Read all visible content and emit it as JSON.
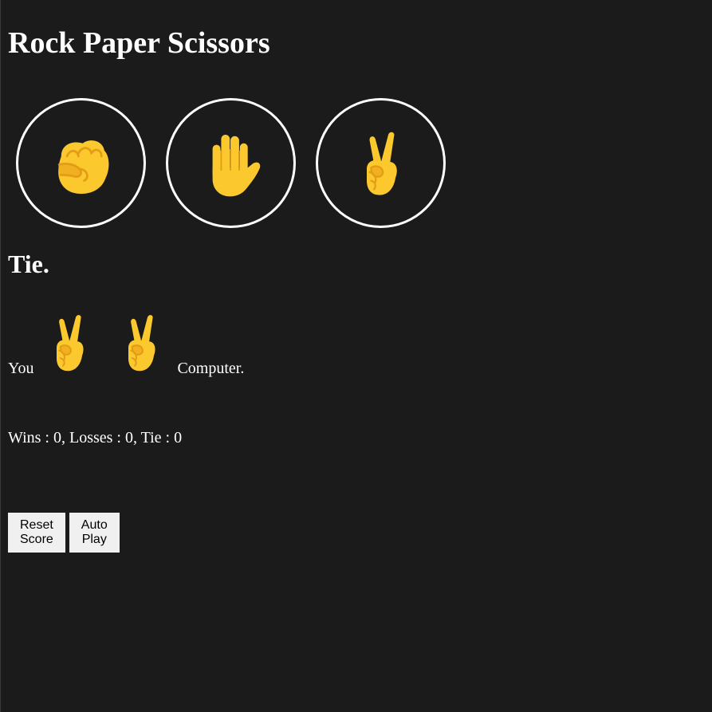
{
  "title": "Rock Paper Scissors",
  "move_buttons": [
    {
      "icon": "fist-icon",
      "emoji": "✊"
    },
    {
      "icon": "raised-hand-icon",
      "emoji": "✋"
    },
    {
      "icon": "victory-hand-icon",
      "emoji": "✌️"
    }
  ],
  "result": "Tie.",
  "moves_line": {
    "you_label": "You",
    "player_move_icon": "victory-hand-icon",
    "computer_move_icon": "victory-hand-icon",
    "computer_label": "Computer."
  },
  "score": "Wins : 0, Losses : 0, Tie : 0",
  "buttons": {
    "reset": "Reset Score",
    "auto_play": "Auto Play"
  },
  "colors": {
    "background": "#1b1b1b",
    "text": "#ffffff",
    "emoji": "#fbc82e",
    "emoji_shadow": "#e39c16",
    "button_bg": "#f0f0f0"
  }
}
